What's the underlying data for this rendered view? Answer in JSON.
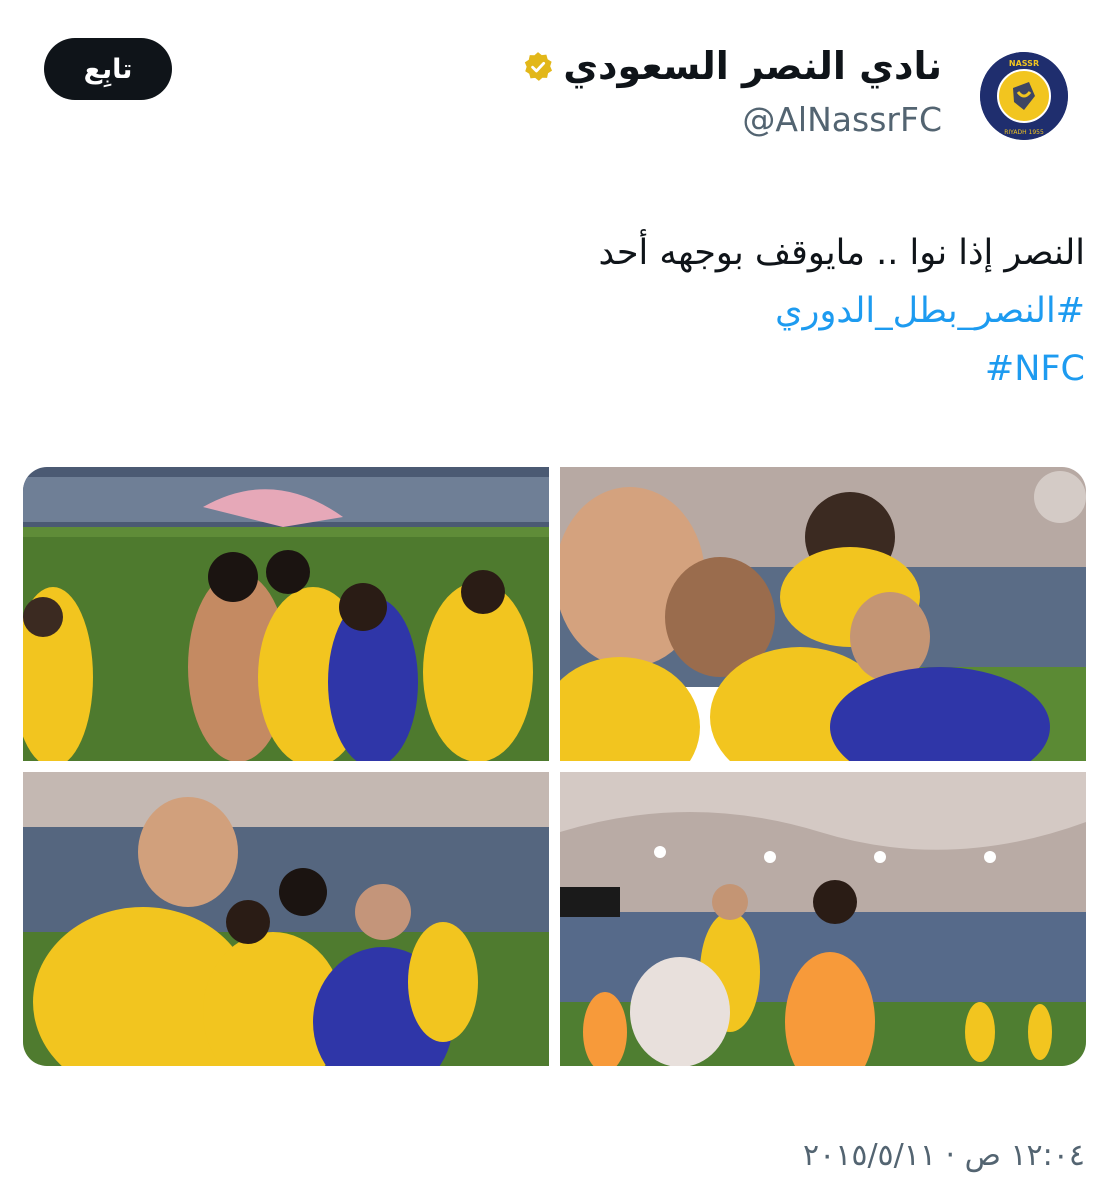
{
  "author": {
    "display_name": "نادي النصر السعودي",
    "handle": "@AlNassrFC",
    "avatar_logo_text_top": "NASSR",
    "avatar_logo_text_bottom": "RIYADH 1955",
    "verified_badge_color": "#e2b719"
  },
  "follow_button": {
    "label": "تابِع"
  },
  "tweet": {
    "text": "النصر إذا نوا .. مايوقف بوجهه أحد",
    "hashtags": [
      "#النصر_بطل_الدوري",
      "#NFC"
    ],
    "hashtag_color": "#1d9bf0",
    "timestamp": "١٢:٠٤ ص · ٢٠١٥/٥/١١"
  },
  "media": [
    {
      "name": "photo-top-right"
    },
    {
      "name": "photo-top-left"
    },
    {
      "name": "photo-bottom-right"
    },
    {
      "name": "photo-bottom-left"
    }
  ],
  "colors": {
    "text": "#0f1419",
    "secondary": "#536471",
    "club_yellow": "#f2c51f",
    "club_blue": "#1f2e6e"
  }
}
